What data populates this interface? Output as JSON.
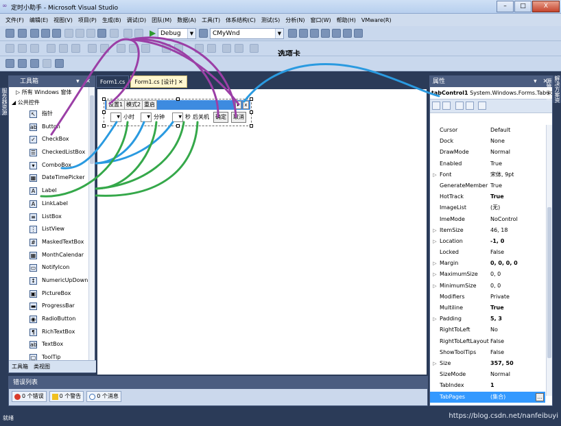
{
  "window": {
    "title": "定时小助手 - Microsoft Visual Studio",
    "minimize": "–",
    "maximize": "□",
    "close": "X"
  },
  "menu": [
    "文件(F)",
    "编辑(E)",
    "视图(V)",
    "项目(P)",
    "生成(B)",
    "调试(D)",
    "团队(M)",
    "数据(A)",
    "工具(T)",
    "体系结构(C)",
    "测试(S)",
    "分析(N)",
    "窗口(W)",
    "帮助(H)",
    "VMware(R)"
  ],
  "toolbar": {
    "config": "Debug",
    "target": "CMyWnd"
  },
  "annotation": "选项卡",
  "toolbox": {
    "title": "工具箱",
    "groups": [
      "▷ 所有 Windows 窗体",
      "◢ 公共控件"
    ],
    "items": [
      {
        "label": "指针",
        "icon": "pointer-icon",
        "glyph": "↖"
      },
      {
        "label": "Button",
        "icon": "button-icon",
        "glyph": "ab"
      },
      {
        "label": "CheckBox",
        "icon": "checkbox-icon",
        "glyph": "✓"
      },
      {
        "label": "CheckedListBox",
        "icon": "checkedlistbox-icon",
        "glyph": "☰"
      },
      {
        "label": "ComboBox",
        "icon": "combobox-icon",
        "glyph": "▾"
      },
      {
        "label": "DateTimePicker",
        "icon": "datetimepicker-icon",
        "glyph": "▦"
      },
      {
        "label": "Label",
        "icon": "label-icon",
        "glyph": "A"
      },
      {
        "label": "LinkLabel",
        "icon": "linklabel-icon",
        "glyph": "A"
      },
      {
        "label": "ListBox",
        "icon": "listbox-icon",
        "glyph": "≡"
      },
      {
        "label": "ListView",
        "icon": "listview-icon",
        "glyph": "⋮"
      },
      {
        "label": "MaskedTextBox",
        "icon": "maskedtextbox-icon",
        "glyph": "#"
      },
      {
        "label": "MonthCalendar",
        "icon": "monthcalendar-icon",
        "glyph": "▦"
      },
      {
        "label": "NotifyIcon",
        "icon": "notifyicon-icon",
        "glyph": "▭"
      },
      {
        "label": "NumericUpDown",
        "icon": "numericupdown-icon",
        "glyph": "↕"
      },
      {
        "label": "PictureBox",
        "icon": "picturebox-icon",
        "glyph": "▣"
      },
      {
        "label": "ProgressBar",
        "icon": "progressbar-icon",
        "glyph": "▬"
      },
      {
        "label": "RadioButton",
        "icon": "radiobutton-icon",
        "glyph": "◉"
      },
      {
        "label": "RichTextBox",
        "icon": "richtextbox-icon",
        "glyph": "¶"
      },
      {
        "label": "TextBox",
        "icon": "textbox-icon",
        "glyph": "ab"
      },
      {
        "label": "ToolTip",
        "icon": "tooltip-icon",
        "glyph": "▢"
      }
    ],
    "bottom_tabs": [
      "工具箱",
      "类视图"
    ]
  },
  "doc_tabs": [
    "Form1.cs",
    "Form1.cs [设计]"
  ],
  "designer": {
    "tabs": [
      "设置1",
      "模式2",
      "重启"
    ],
    "controls": {
      "label_hour": "小时",
      "label_min": "分钟",
      "label_sec": "秒",
      "label_shutdown": "后关机",
      "btn_ok": "确定",
      "btn_cancel": "取消"
    }
  },
  "error_list": {
    "title": "错误列表",
    "errors": "0 个错误",
    "warnings": "0 个警告",
    "messages": "0 个消息"
  },
  "properties": {
    "title": "属性",
    "object_name": "tabControl1",
    "object_type": "System.Windows.Forms.TabContro",
    "rows": [
      {
        "name": "Cursor",
        "value": "Default",
        "bold": false,
        "exp": ""
      },
      {
        "name": "Dock",
        "value": "None",
        "bold": false,
        "exp": ""
      },
      {
        "name": "DrawMode",
        "value": "Normal",
        "bold": false,
        "exp": ""
      },
      {
        "name": "Enabled",
        "value": "True",
        "bold": false,
        "exp": ""
      },
      {
        "name": "Font",
        "value": "宋体, 9pt",
        "bold": false,
        "exp": "▷"
      },
      {
        "name": "GenerateMember",
        "value": "True",
        "bold": false,
        "exp": ""
      },
      {
        "name": "HotTrack",
        "value": "True",
        "bold": true,
        "exp": ""
      },
      {
        "name": "ImageList",
        "value": "(无)",
        "bold": false,
        "exp": ""
      },
      {
        "name": "ImeMode",
        "value": "NoControl",
        "bold": false,
        "exp": ""
      },
      {
        "name": "ItemSize",
        "value": "46, 18",
        "bold": false,
        "exp": "▷"
      },
      {
        "name": "Location",
        "value": "-1, 0",
        "bold": true,
        "exp": "▷"
      },
      {
        "name": "Locked",
        "value": "False",
        "bold": false,
        "exp": ""
      },
      {
        "name": "Margin",
        "value": "0, 0, 0, 0",
        "bold": true,
        "exp": "▷"
      },
      {
        "name": "MaximumSize",
        "value": "0, 0",
        "bold": false,
        "exp": "▷"
      },
      {
        "name": "MinimumSize",
        "value": "0, 0",
        "bold": false,
        "exp": "▷"
      },
      {
        "name": "Modifiers",
        "value": "Private",
        "bold": false,
        "exp": ""
      },
      {
        "name": "Multiline",
        "value": "True",
        "bold": true,
        "exp": ""
      },
      {
        "name": "Padding",
        "value": "5, 3",
        "bold": true,
        "exp": "▷"
      },
      {
        "name": "RightToLeft",
        "value": "No",
        "bold": false,
        "exp": ""
      },
      {
        "name": "RightToLeftLayout",
        "value": "False",
        "bold": false,
        "exp": ""
      },
      {
        "name": "ShowToolTips",
        "value": "False",
        "bold": false,
        "exp": ""
      },
      {
        "name": "Size",
        "value": "357, 50",
        "bold": true,
        "exp": "▷"
      },
      {
        "name": "SizeMode",
        "value": "Normal",
        "bold": false,
        "exp": ""
      },
      {
        "name": "TabIndex",
        "value": "1",
        "bold": true,
        "exp": ""
      },
      {
        "name": "TabPages",
        "value": "(集合)",
        "bold": false,
        "exp": "",
        "selected": true
      }
    ]
  },
  "status": {
    "ready": "就绪",
    "watermark": "https://blog.csdn.net/nanfeibuyi"
  },
  "side_strips": {
    "left": "服务器资源管理器",
    "right": "解决方案资源管理器"
  },
  "colors": {
    "annotation_purple": "#9b3fa6",
    "annotation_blue": "#2a9ae0",
    "annotation_green": "#35a84a",
    "tab_header_blue": "#3d8be0",
    "selection_blue": "#3399ff"
  }
}
